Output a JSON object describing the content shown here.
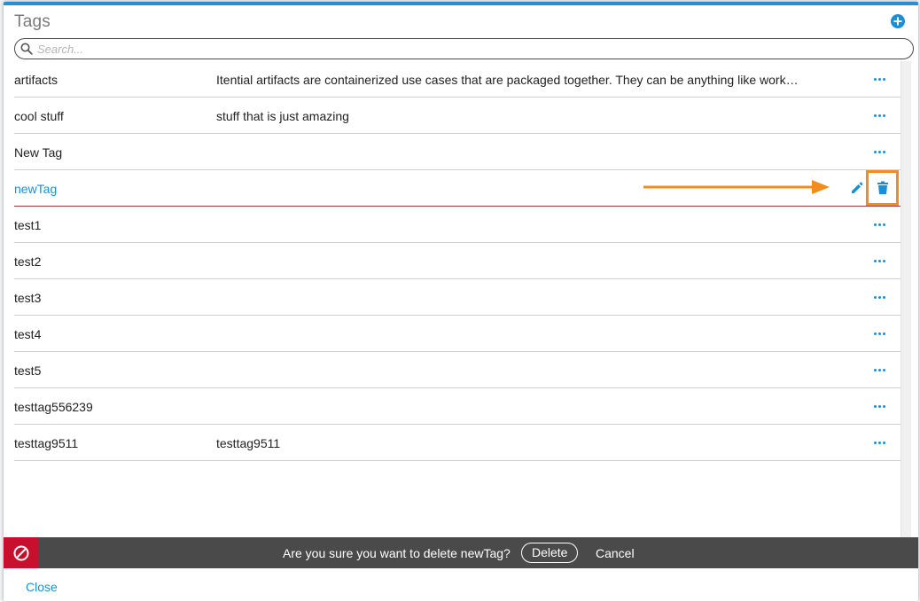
{
  "modal": {
    "title": "Tags",
    "add_icon": "plus-circle-icon"
  },
  "search": {
    "placeholder": "Search...",
    "value": "",
    "icon": "search-icon"
  },
  "tags": [
    {
      "name": "artifacts",
      "description": "Itential artifacts are containerized use cases that are packaged together. They can be anything like work…"
    },
    {
      "name": "cool stuff",
      "description": "stuff that is just amazing"
    },
    {
      "name": "New Tag",
      "description": ""
    },
    {
      "name": "newTag",
      "description": "",
      "selected": true
    },
    {
      "name": "test1",
      "description": ""
    },
    {
      "name": "test2",
      "description": ""
    },
    {
      "name": "test3",
      "description": ""
    },
    {
      "name": "test4",
      "description": ""
    },
    {
      "name": "test5",
      "description": ""
    },
    {
      "name": "testtag556239",
      "description": ""
    },
    {
      "name": "testtag9511",
      "description": "testtag9511"
    }
  ],
  "row_actions": {
    "more_icon": "ellipsis-icon",
    "edit_icon": "pencil-icon",
    "delete_icon": "trash-icon"
  },
  "confirm": {
    "message": "Are you sure you want to delete newTag?",
    "delete_label": "Delete",
    "cancel_label": "Cancel",
    "icon": "ban-icon"
  },
  "footer": {
    "close_label": "Close"
  },
  "colors": {
    "accent": "#1a8fd6",
    "header_bar": "#2b8ed1",
    "confirm_bar": "#4a4a4a",
    "danger": "#c8102e",
    "highlight": "#f28c1f"
  }
}
